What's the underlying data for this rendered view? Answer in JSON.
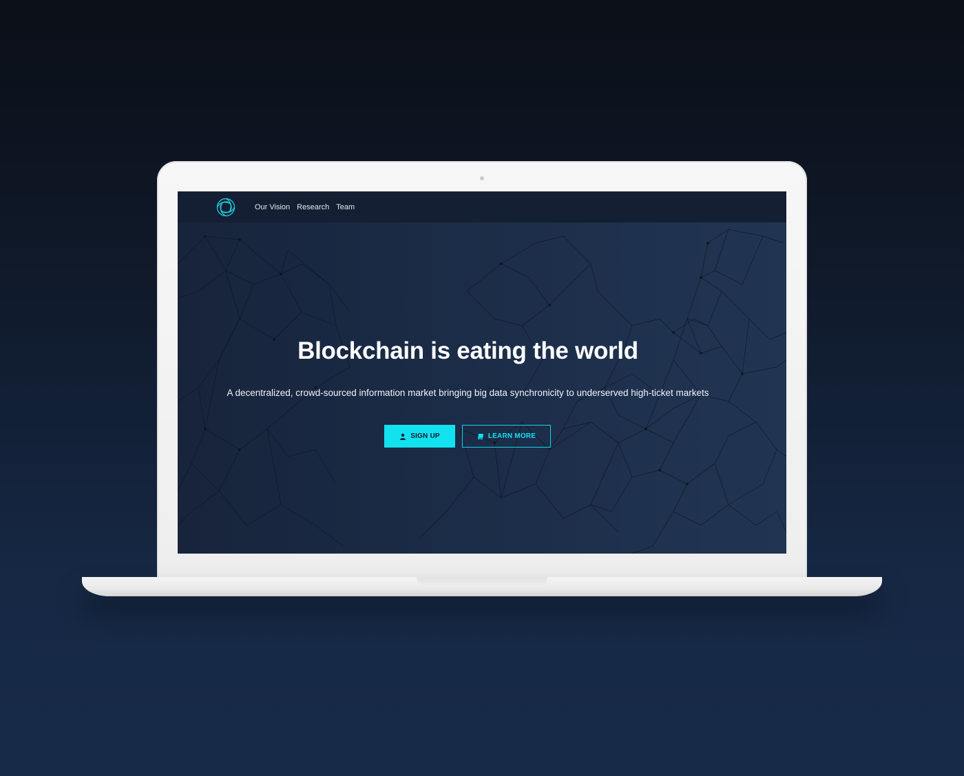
{
  "nav": {
    "links": [
      "Our Vision",
      "Research",
      "Team"
    ]
  },
  "hero": {
    "title": "Blockchain is eating the world",
    "subtitle": "A decentralized, crowd-sourced information market bringing big data synchronicity to underserved high-ticket markets",
    "primary_button": "SIGN UP",
    "secondary_button": "LEARN MORE"
  },
  "icons": {
    "logo": "ring-logo-icon",
    "signup": "user-icon",
    "learn": "book-icon"
  },
  "colors": {
    "accent": "#12e1f0",
    "navbar": "#141f33",
    "hero": "#1b2c47",
    "page_background": "#101b2d",
    "laptop": "#f2f2f2"
  }
}
